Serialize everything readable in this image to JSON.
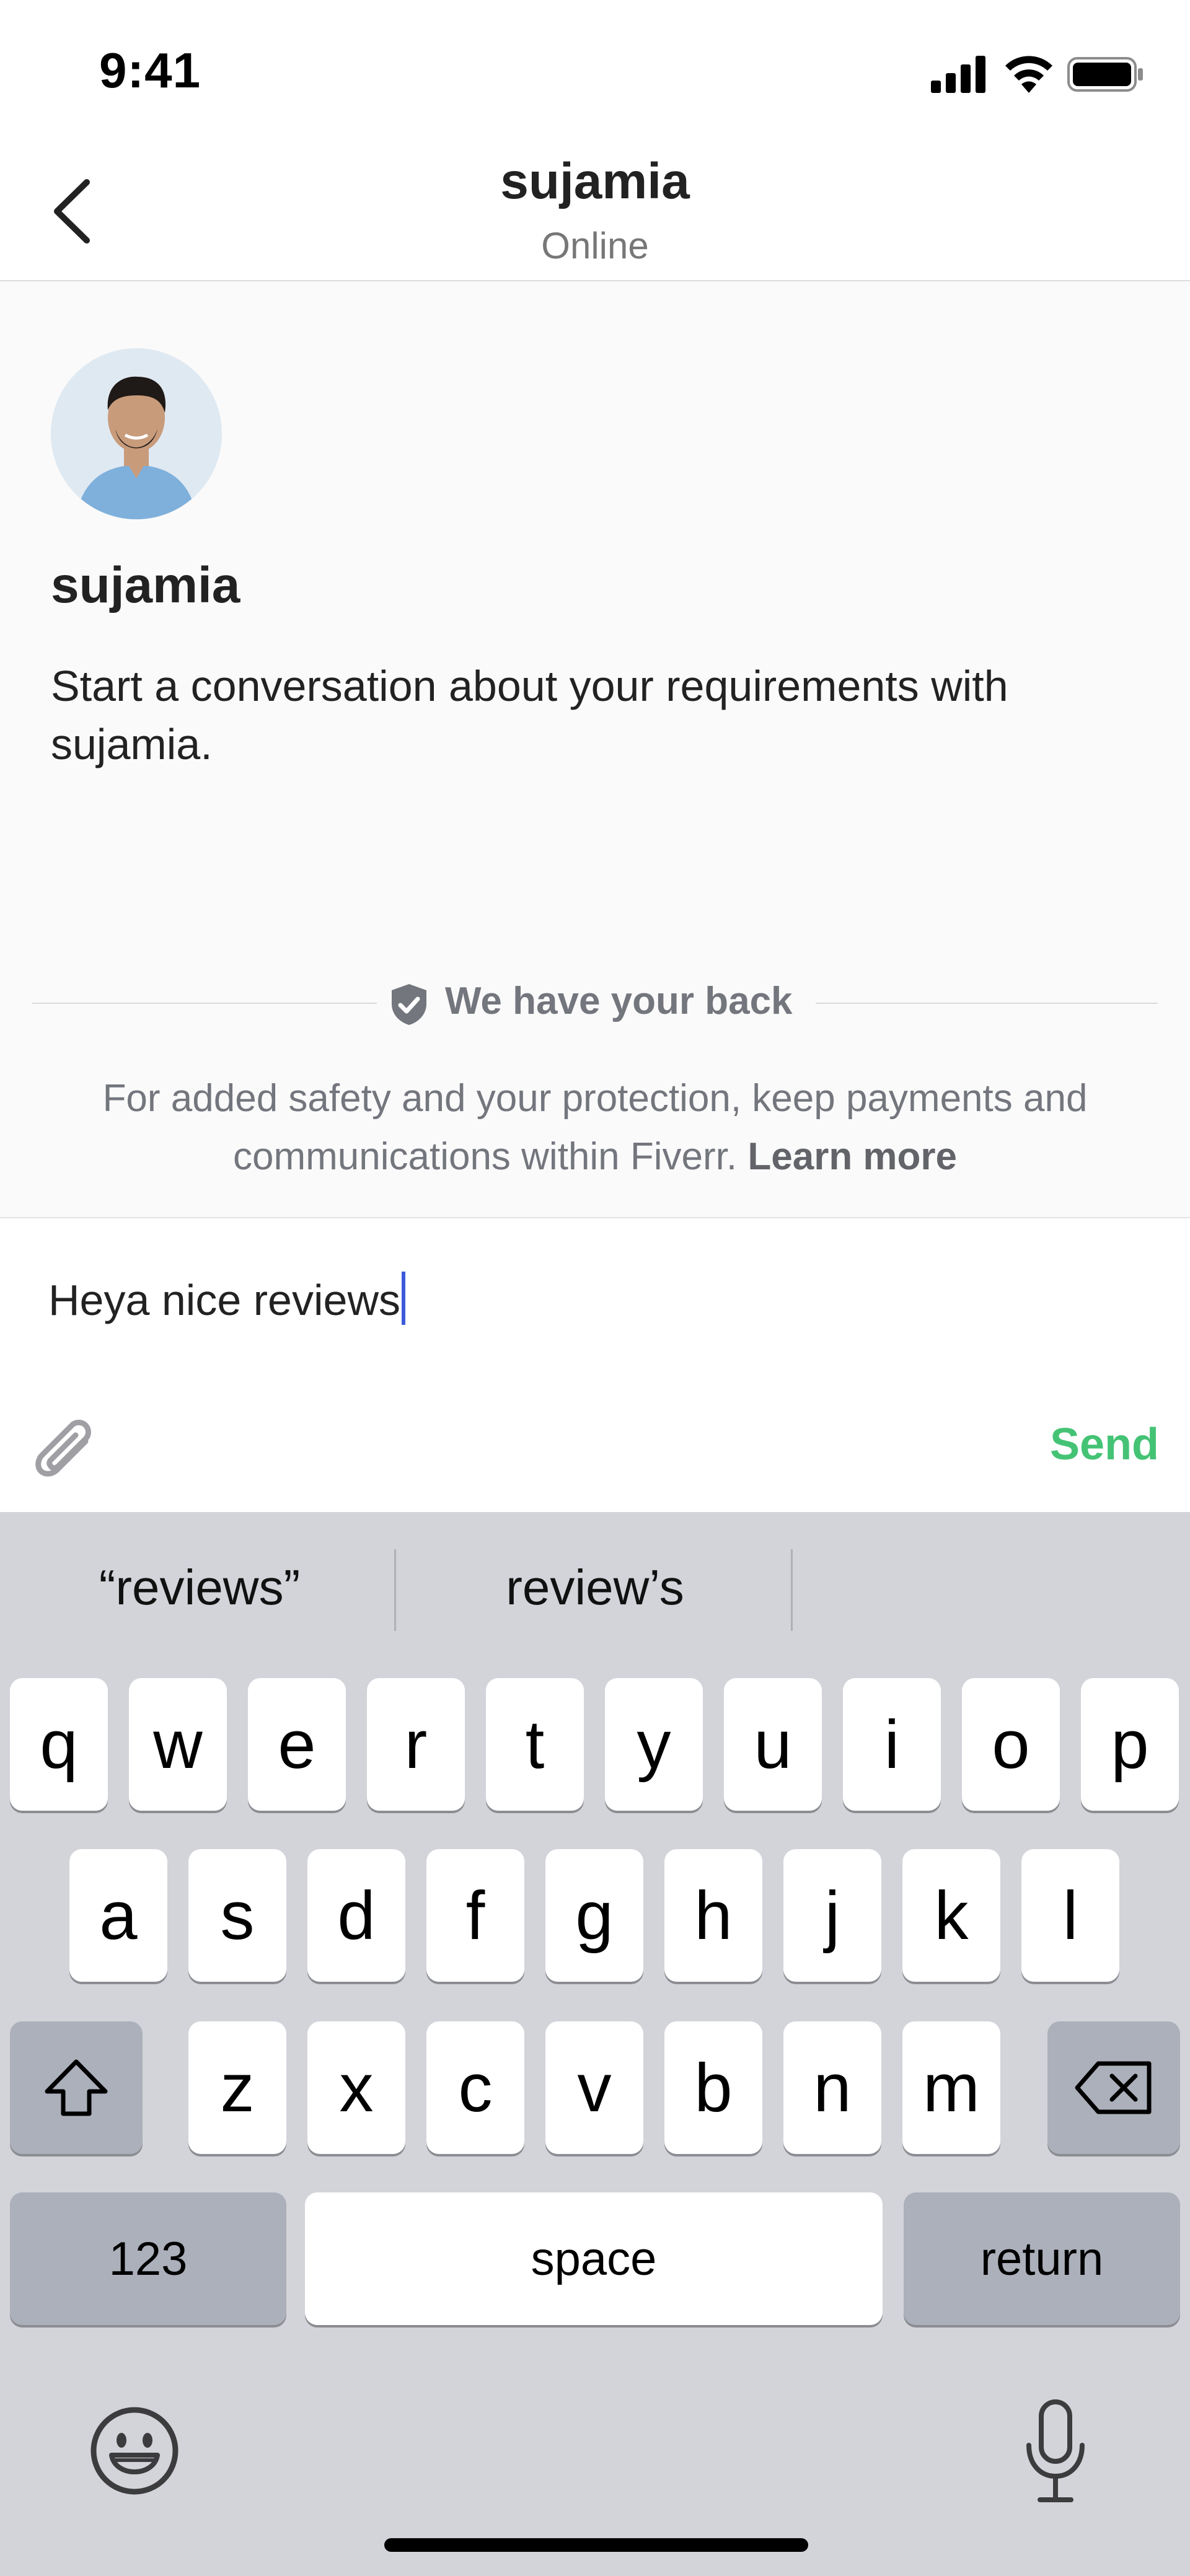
{
  "status_bar": {
    "time": "9:41"
  },
  "header": {
    "title": "sujamia",
    "subtitle": "Online"
  },
  "profile": {
    "name": "sujamia",
    "description": "Start a conversation about your requirements with sujamia."
  },
  "safety": {
    "title": "We have your back",
    "text": "For added safety and your protection, keep payments and communications within Fiverr.",
    "link": "Learn more"
  },
  "composer": {
    "message": "Heya nice reviews",
    "send_label": "Send"
  },
  "keyboard": {
    "suggestions": [
      "“reviews”",
      "review’s",
      ""
    ],
    "row1": [
      "q",
      "w",
      "e",
      "r",
      "t",
      "y",
      "u",
      "i",
      "o",
      "p"
    ],
    "row2": [
      "a",
      "s",
      "d",
      "f",
      "g",
      "h",
      "j",
      "k",
      "l"
    ],
    "row3": [
      "z",
      "x",
      "c",
      "v",
      "b",
      "n",
      "m"
    ],
    "numbers_label": "123",
    "space_label": "space",
    "return_label": "return"
  },
  "colors": {
    "accent_green": "#45c375",
    "caret_blue": "#3b5bdb",
    "keyboard_bg": "#d2d4da"
  }
}
